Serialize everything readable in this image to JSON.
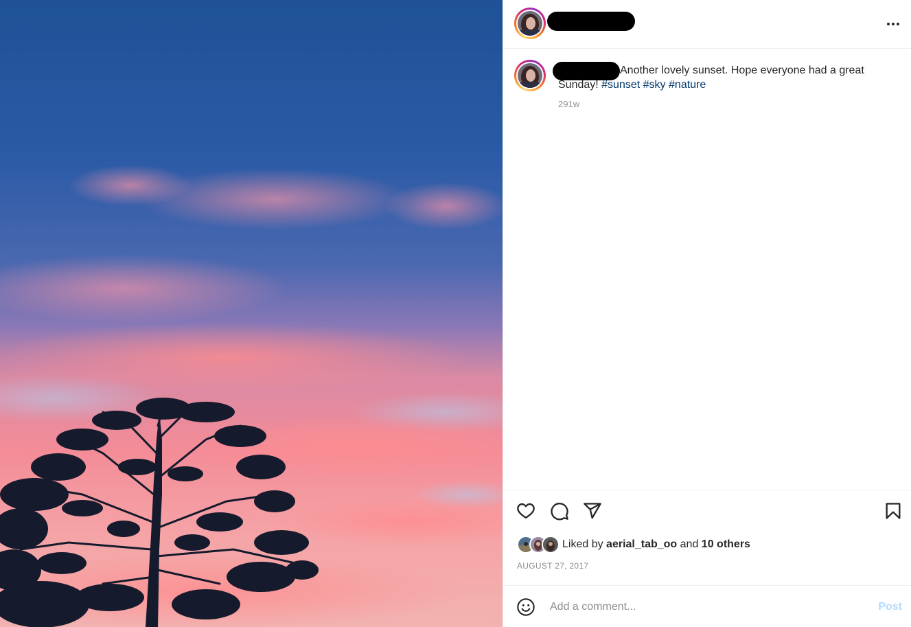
{
  "post": {
    "caption_text": "Another lovely sunset. Hope everyone had a great Sunday! ",
    "hashtags": [
      "#sunset",
      "#sky",
      "#nature"
    ],
    "time_ago": "291w"
  },
  "likes": {
    "prefix": "Liked by ",
    "user": "aerial_tab_oo",
    "middle": " and ",
    "others": "10 others"
  },
  "date": "AUGUST 27, 2017",
  "comment": {
    "placeholder": "Add a comment...",
    "post_label": "Post"
  },
  "icons": [
    "more-options-icon",
    "heart-icon",
    "comment-icon",
    "share-icon",
    "bookmark-icon",
    "emoji-icon"
  ],
  "colors": {
    "hashtag": "#00376b",
    "post_disabled": "#b3dbff",
    "muted": "#8e8e8e"
  }
}
